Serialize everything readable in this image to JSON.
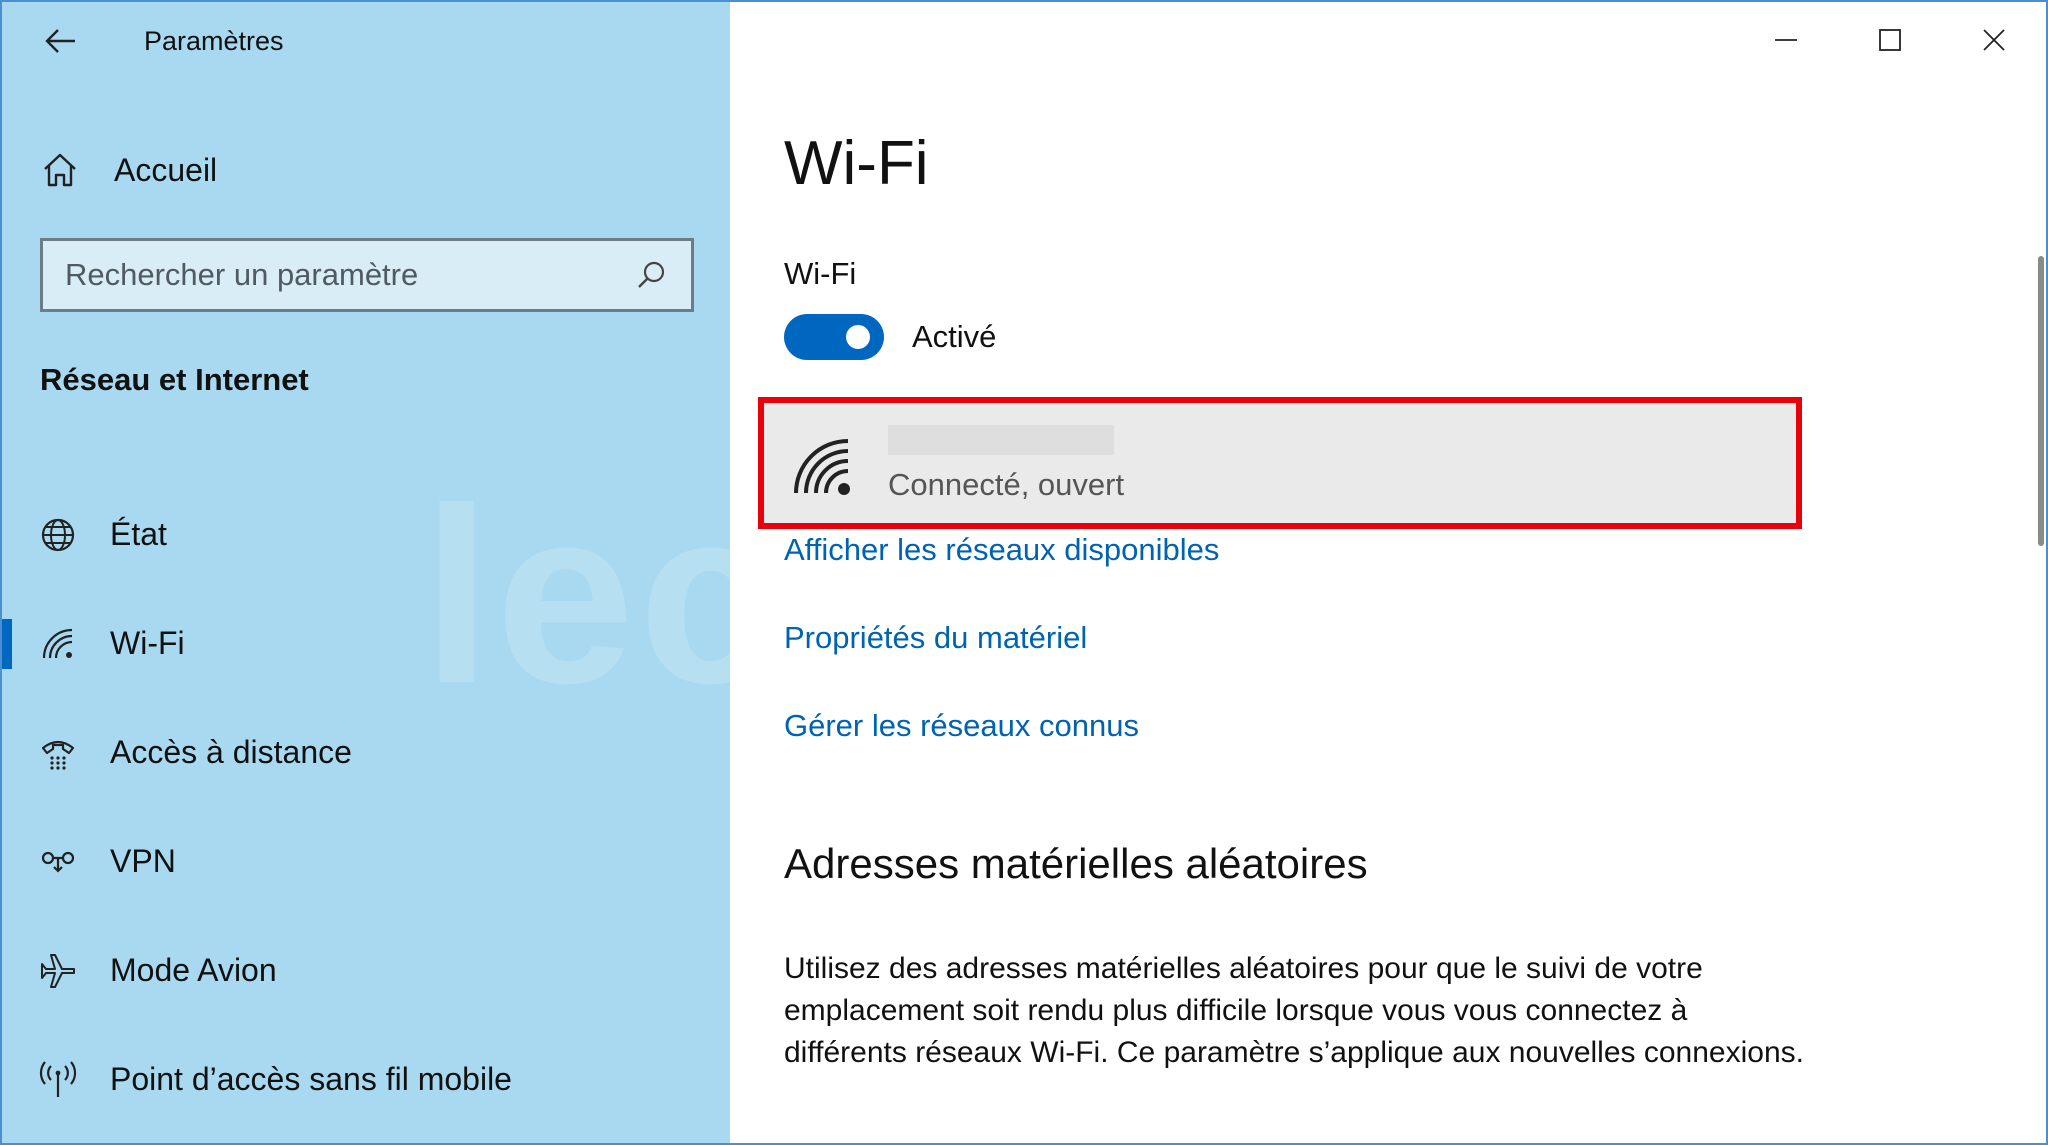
{
  "window": {
    "title": "Paramètres"
  },
  "sidebar": {
    "home_label": "Accueil",
    "search_placeholder": "Rechercher un paramètre",
    "section_title": "Réseau et Internet",
    "items": [
      {
        "label": "État",
        "icon": "globe-icon",
        "active": false
      },
      {
        "label": "Wi-Fi",
        "icon": "wifi-icon",
        "active": true
      },
      {
        "label": "Accès à distance",
        "icon": "dialup-icon",
        "active": false
      },
      {
        "label": "VPN",
        "icon": "vpn-icon",
        "active": false
      },
      {
        "label": "Mode Avion",
        "icon": "airplane-icon",
        "active": false
      },
      {
        "label": "Point d’accès sans fil mobile",
        "icon": "hotspot-icon",
        "active": false
      }
    ]
  },
  "watermark": "lecrabeinfo",
  "main": {
    "page_title": "Wi-Fi",
    "toggle_label": "Wi-Fi",
    "toggle_state": "Activé",
    "toggle_on": true,
    "network": {
      "status": "Connecté, ouvert",
      "icon": "wifi-signal-icon"
    },
    "links": {
      "show_networks": "Afficher les réseaux disponibles",
      "hardware_props": "Propriétés du matériel",
      "manage_known": "Gérer les réseaux connus"
    },
    "random_mac": {
      "title": "Adresses matérielles aléatoires",
      "description": "Utilisez des adresses matérielles aléatoires pour que le suivi de votre emplacement soit rendu plus difficile lorsque vous vous connectez à différents réseaux Wi-Fi. Ce paramètre s’applique aux nouvelles connexions."
    }
  },
  "colors": {
    "sidebar_bg": "#a9d9f0",
    "accent": "#0067c0",
    "link": "#0063b1",
    "highlight_border": "#e8000b"
  }
}
